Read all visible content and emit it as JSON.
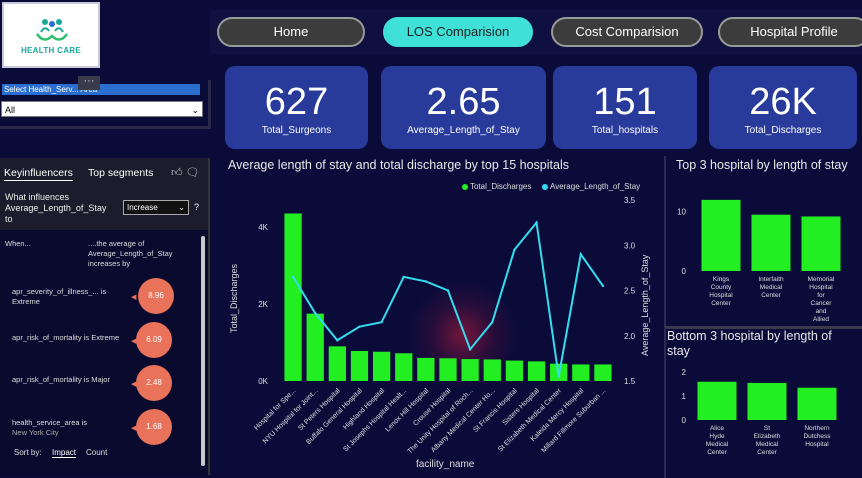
{
  "logo": {
    "text": "HEALTH CARE"
  },
  "slicer": {
    "label": "Select Health_Serv... Area",
    "value": "All",
    "more": "···"
  },
  "nav": {
    "items": [
      "Home",
      "LOS Comparision",
      "Cost Comparision",
      "Hospital Profile"
    ],
    "active": 1
  },
  "kpis": [
    {
      "value": "627",
      "label": "Total_Surgeons"
    },
    {
      "value": "2.65",
      "label": "Average_Length_of_Stay"
    },
    {
      "value": "151",
      "label": "Total_hospitals"
    },
    {
      "value": "26K",
      "label": "Total_Discharges"
    }
  ],
  "key_influencers": {
    "tabs": [
      "Keyinfluencers",
      "Top segments"
    ],
    "question": "What influences Average_Length_of_Stay to",
    "select_value": "Increase",
    "help": "?",
    "when_label": "When...",
    "effect_label": "....the average of Average_Length_of_Stay increases by",
    "factors": [
      {
        "label": "apr_severity_of_illness_... is Extreme",
        "sub": "",
        "value": "8.96"
      },
      {
        "label": "apr_risk_of_mortality is Extreme",
        "sub": "",
        "value": "6.09"
      },
      {
        "label": "apr_risk_of_mortality is Major",
        "sub": "",
        "value": "2.48"
      },
      {
        "label": "health_service_area is",
        "sub": "New York City",
        "value": "1.68"
      }
    ],
    "sort_by": "Sort by:",
    "sort_impact": "Impact",
    "sort_count": "Count"
  },
  "main_chart": {
    "title": "Average length of stay and total discharge by top 15 hospitals",
    "legend": [
      "Total_Discharges",
      "Average_Length_of_Stay"
    ]
  },
  "top3": {
    "title": "Top 3 hospital by length of stay"
  },
  "bot3": {
    "title": "Bottom 3 hospital by length of stay"
  },
  "chart_data": [
    {
      "type": "bar+line",
      "title": "Average length of stay and total discharge by top 15 hospitals",
      "xlabel": "facility_name",
      "ylabel": "Total_Discharges",
      "y2label": "Average_Length_of_Stay",
      "categories": [
        "Hospital for Spe...",
        "NYU Hospital for Joint...",
        "St Peters Hospital",
        "Buffalo General Hospital",
        "Highland Hospital",
        "St Josephs Hospital Healt...",
        "Lenox Hill Hospital",
        "Crouse Hospital",
        "The Unity Hospital of Roch...",
        "Albany Medical Center Ho...",
        "St Francis Hospital",
        "Sisters Hospital",
        "St Elizabeth Medical Center",
        "Kaleida Mercy Hospital",
        "Millard Fillmore Suburban ..."
      ],
      "series": [
        {
          "name": "Total_Discharges",
          "axis": "left",
          "values": [
            4350,
            1750,
            900,
            780,
            760,
            720,
            600,
            590,
            570,
            560,
            530,
            510,
            450,
            430,
            430
          ]
        },
        {
          "name": "Average_Length_of_Stay",
          "axis": "right",
          "values": [
            2.65,
            2.25,
            1.95,
            2.1,
            2.15,
            2.65,
            2.6,
            2.5,
            1.85,
            2.15,
            2.95,
            3.25,
            1.55,
            2.9,
            2.55
          ]
        }
      ],
      "yticks": [
        "0K",
        "2K",
        "4K"
      ],
      "ylim": [
        0,
        4700
      ],
      "y2ticks": [
        "1.5",
        "2.0",
        "2.5",
        "3.0",
        "3.5"
      ],
      "y2lim": [
        1.5,
        3.5
      ],
      "legend": "top-right"
    },
    {
      "type": "bar",
      "title": "Top 3 hospital by length of stay",
      "categories": [
        "Kings County Hospital Center",
        "Interfaith Medical Center",
        "Memorial Hospital for Cancer and Allied Diseases"
      ],
      "values": [
        12,
        9.5,
        9.2
      ],
      "yticks": [
        "0",
        "10"
      ],
      "ylim": [
        0,
        14
      ]
    },
    {
      "type": "bar",
      "title": "Bottom 3 hospital by length of stay",
      "categories": [
        "Alice Hyde Medical Center",
        "St Elizabeth Medical Center",
        "Northern Dutchess Hospital"
      ],
      "values": [
        1.6,
        1.55,
        1.35
      ],
      "yticks": [
        "0",
        "1",
        "2"
      ],
      "ylim": [
        0,
        2.3
      ]
    }
  ]
}
